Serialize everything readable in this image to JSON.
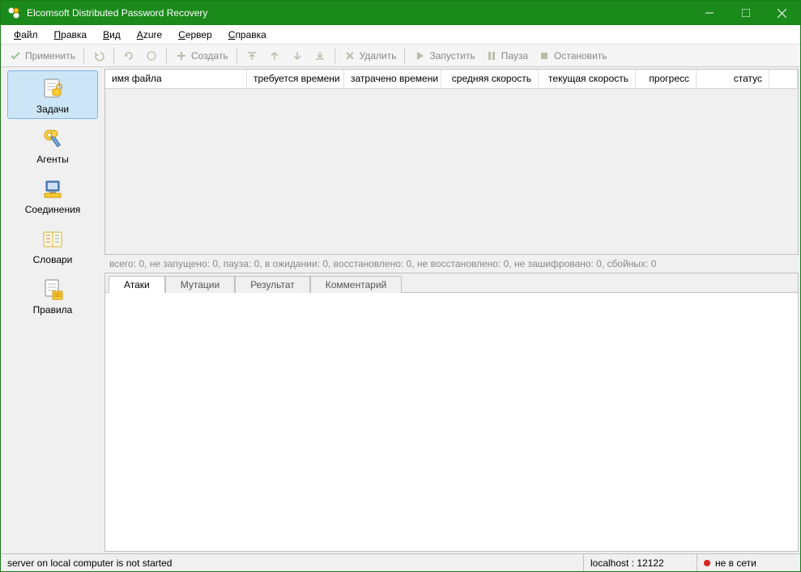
{
  "title": "Elcomsoft Distributed Password Recovery",
  "menu": {
    "file": "Файл",
    "edit": "Правка",
    "view": "Вид",
    "azure": "Azure",
    "server": "Сервер",
    "help": "Справка"
  },
  "toolbar": {
    "apply": "Применить",
    "create": "Создать",
    "delete": "Удалить",
    "start": "Запустить",
    "pause": "Пауза",
    "stop": "Остановить"
  },
  "sidebar": {
    "tasks": "Задачи",
    "agents": "Агенты",
    "connections": "Соединения",
    "dictionaries": "Словари",
    "rules": "Правила"
  },
  "columns": {
    "filename": "имя файла",
    "required_time": "требуется времени",
    "spent_time": "затрачено времени",
    "avg_speed": "средняя скорость",
    "cur_speed": "текущая скорость",
    "progress": "прогресс",
    "status": "статус"
  },
  "summary": "всего: 0,   не запущено: 0,   пауза: 0,   в ожидании: 0,   восстановлено: 0,   не восстановлено: 0,   не зашифровано: 0,   сбойных: 0",
  "tabs": {
    "attacks": "Атаки",
    "mutations": "Мутации",
    "result": "Результат",
    "comment": "Комментарий"
  },
  "status": {
    "server_msg": "server on local computer is not started",
    "host": "localhost : 12122",
    "connection": "не в сети"
  }
}
